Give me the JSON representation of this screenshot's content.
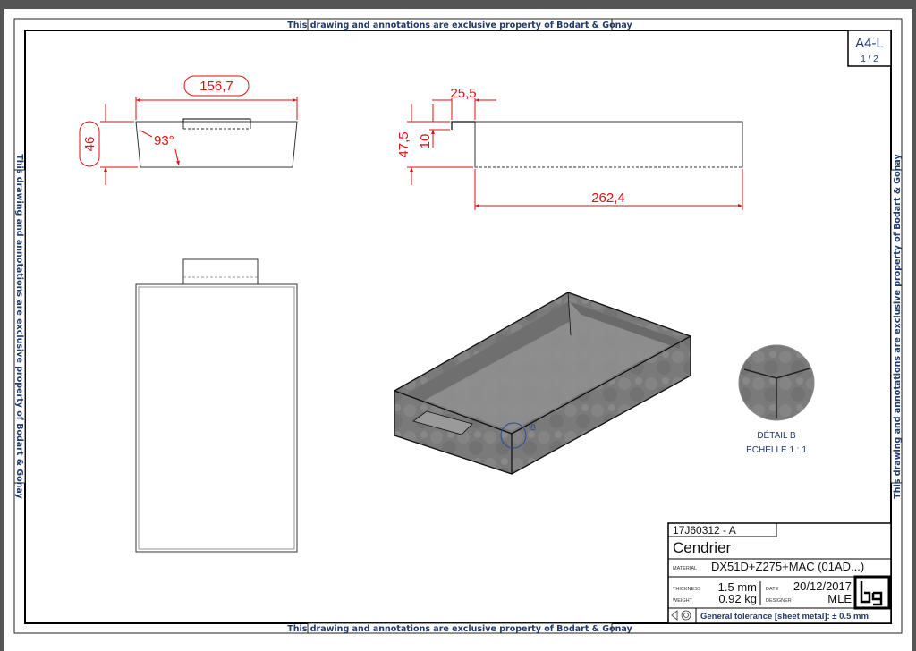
{
  "banner": "This drawing and annotations are exclusive property of Bodart & Gonay",
  "sheet": {
    "format": "A4-L",
    "page": "1 / 2"
  },
  "front_view": {
    "width": "156,7",
    "height": "46",
    "angle": "93°"
  },
  "side_view": {
    "flange": "25,5",
    "height": "47,5",
    "flange_height": "10",
    "length": "262,4"
  },
  "detail": {
    "marker": "B",
    "title": "DÉTAIL B",
    "scale": "ECHELLE 1 : 1"
  },
  "title_block": {
    "reference": "17J60312 - A",
    "name": "Cendrier",
    "material_label": "MATERIAL",
    "material": "DX51D+Z275+MAC (01AD...)",
    "thickness_label": "THICKNESS",
    "thickness": "1.5 mm",
    "weight_label": "WEIGHT",
    "weight": "0.92 kg",
    "date_label": "DATE",
    "date": "20/12/2017",
    "designer_label": "DESIGNER",
    "designer": "MLE",
    "logo": "bg",
    "tolerance": "General tolerance [sheet metal]: ± 0.5 mm"
  },
  "colors": {
    "dimension": "#dd1111",
    "banner_text": "#1f3a6b",
    "frame": "#000000"
  }
}
